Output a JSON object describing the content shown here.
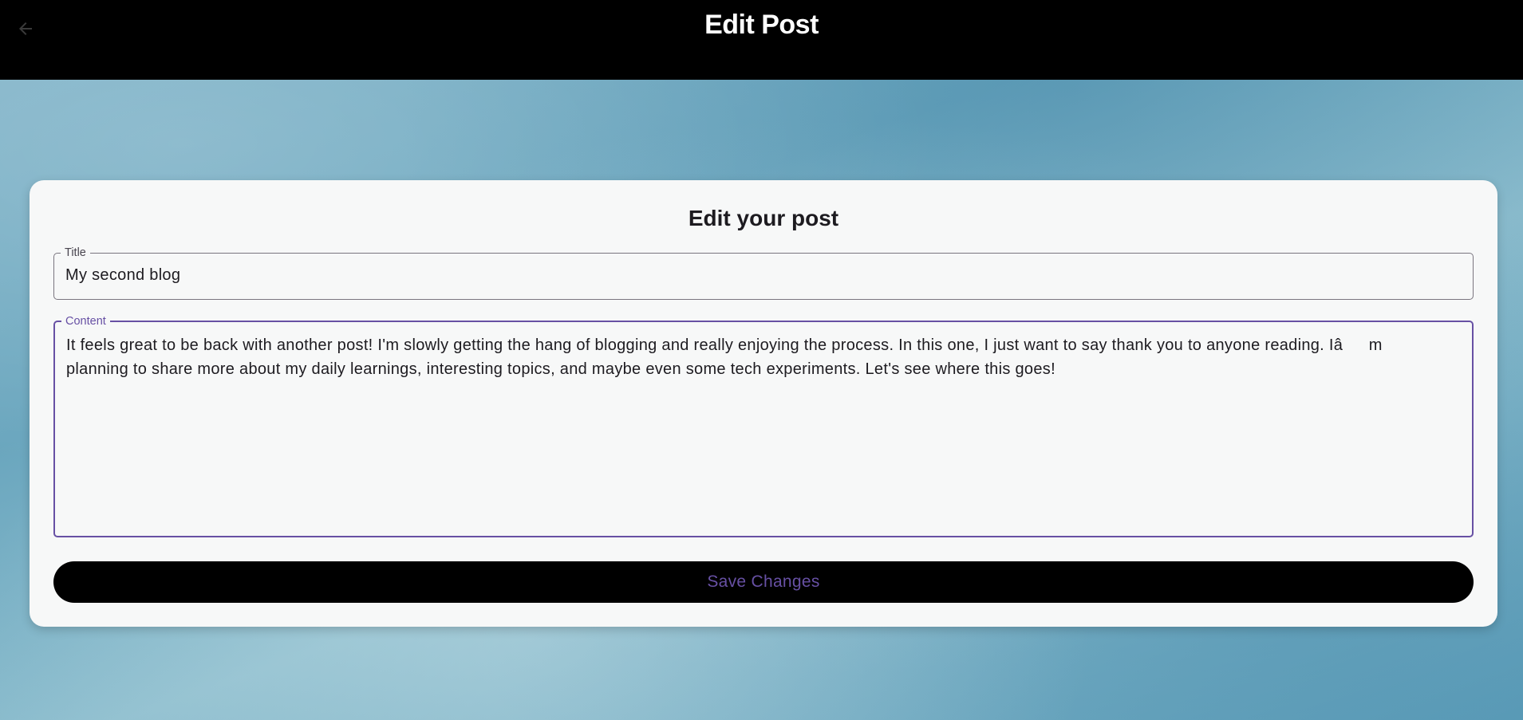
{
  "app_bar": {
    "title": "Edit Post",
    "back_icon": "arrow-back-icon"
  },
  "form": {
    "heading": "Edit your post",
    "title_field": {
      "label": "Title",
      "value": "My second blog"
    },
    "content_field": {
      "label": "Content",
      "value": "It feels great to be back with another post! I'm slowly getting the hang of blogging and really enjoying the process. In this one, I just want to say thank you to anyone reading. Iâm planning to share more about my daily learnings, interesting topics, and maybe even some tech experiments. Let's see where this goes!"
    },
    "save_label": "Save Changes"
  },
  "colors": {
    "app_bar": "#000000",
    "accent": "#6750a4",
    "card": "#f7f8f8"
  }
}
